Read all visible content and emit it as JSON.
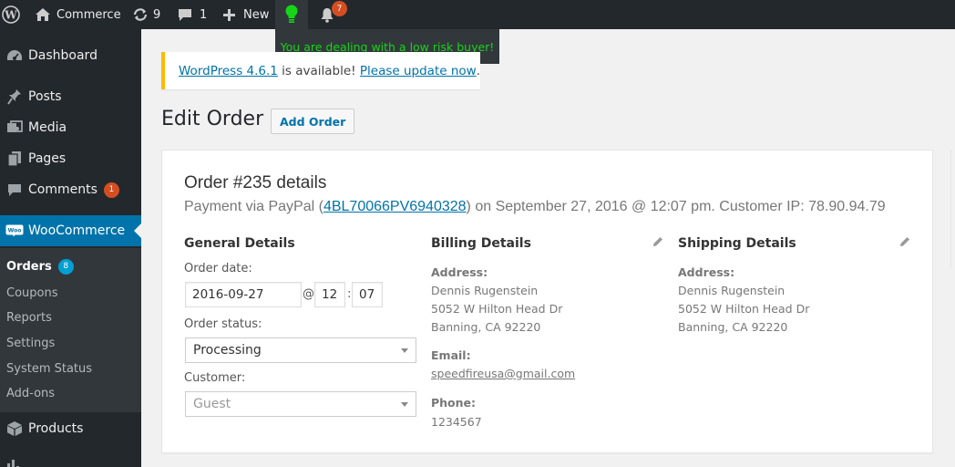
{
  "adminbar": {
    "site_name": "Commerce",
    "updates_count": "9",
    "comments_count": "1",
    "new_label": "New",
    "notification_count": "7",
    "bulb_color": "#15d615"
  },
  "tooltip": {
    "text": "You are dealing with a low risk buyer!"
  },
  "sidebar": {
    "dashboard": "Dashboard",
    "posts": "Posts",
    "media": "Media",
    "pages": "Pages",
    "comments": "Comments",
    "comments_badge": "1",
    "woocommerce": "WooCommerce",
    "submenu": {
      "orders": "Orders",
      "orders_badge": "8",
      "coupons": "Coupons",
      "reports": "Reports",
      "settings": "Settings",
      "system_status": "System Status",
      "addons": "Add-ons"
    },
    "products": "Products"
  },
  "notice": {
    "version_link": "WordPress 4.6.1",
    "middle_text": " is available! ",
    "update_link": "Please update now",
    "end_text": "."
  },
  "page": {
    "title": "Edit Order",
    "add_order_label": "Add Order"
  },
  "order": {
    "heading": "Order #235 details",
    "payment_prefix": "Payment via PayPal (",
    "transaction_id": "4BL70066PV6940328",
    "payment_suffix": ") on September 27, 2016 @ 12:07 pm. Customer IP: 78.90.94.79",
    "general": {
      "title": "General Details",
      "order_date_label": "Order date:",
      "order_date": "2016-09-27",
      "at_symbol": "@",
      "hour": "12",
      "colon": ":",
      "minute": "07",
      "status_label": "Order status:",
      "status_value": "Processing",
      "customer_label": "Customer:",
      "customer_value": "Guest"
    },
    "billing": {
      "title": "Billing Details",
      "address_label": "Address:",
      "name": "Dennis Rugenstein",
      "street": "5052 W Hilton Head Dr",
      "city": "Banning, CA 92220",
      "email_label": "Email:",
      "email": "speedfireusa@gmail.com",
      "phone_label": "Phone:",
      "phone": "1234567"
    },
    "shipping": {
      "title": "Shipping Details",
      "address_label": "Address:",
      "name": "Dennis Rugenstein",
      "street": "5052 W Hilton Head Dr",
      "city": "Banning, CA 92220"
    }
  }
}
